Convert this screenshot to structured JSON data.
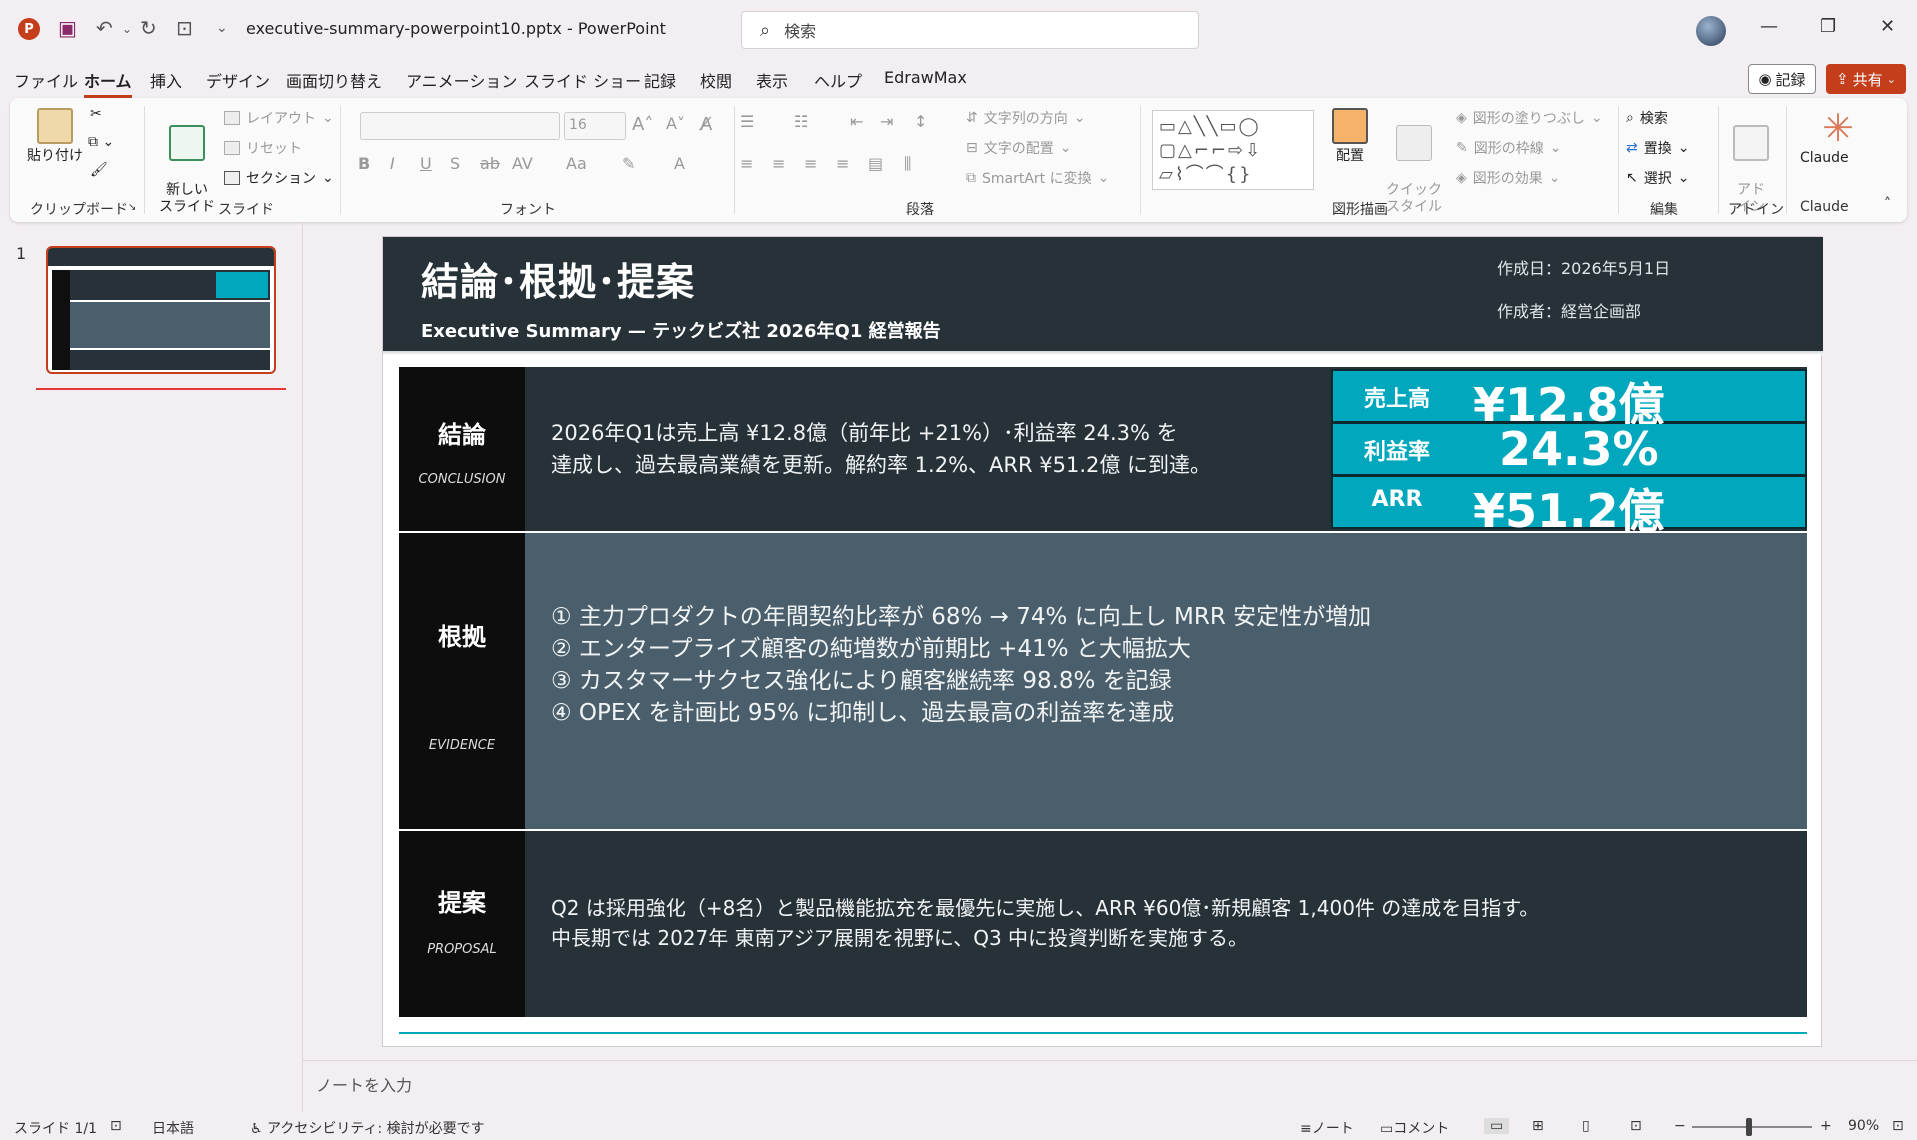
{
  "titlebar": {
    "app_icon": "P",
    "doc_title": "executive-summary-powerpoint10.pptx  -  PowerPoint",
    "search_placeholder": "検索",
    "minimize": "—",
    "restore": "❐",
    "close": "✕"
  },
  "menu": {
    "tabs": [
      "ファイル",
      "ホーム",
      "挿入",
      "デザイン",
      "画面切り替え",
      "アニメーション",
      "スライド ショー",
      "記録",
      "校閲",
      "表示",
      "ヘルプ",
      "EdrawMax"
    ],
    "active": "ホーム",
    "record_btn": "記録",
    "share_btn": "共有"
  },
  "ribbon": {
    "clipboard": {
      "paste": "貼り付け",
      "label": "クリップボード"
    },
    "slides": {
      "new_slide": "新しい\nスライド",
      "layout": "レイアウト",
      "reset": "リセット",
      "section": "セクション",
      "label": "スライド"
    },
    "font": {
      "size": "16",
      "label": "フォント"
    },
    "paragraph": {
      "text_direction": "文字列の方向",
      "align_text": "文字の配置",
      "smartart": "SmartArt に変換",
      "label": "段落"
    },
    "drawing": {
      "arrange": "配置",
      "quick_style": "クイック\nスタイル",
      "fill": "図形の塗りつぶし",
      "outline": "図形の枠線",
      "effects": "図形の効果",
      "label": "図形描画"
    },
    "editing": {
      "find": "検索",
      "replace": "置換",
      "select": "選択",
      "label": "編集"
    },
    "addins": {
      "addin": "アド\nイン",
      "label": "アドイン"
    },
    "claude": {
      "name": "Claude",
      "label": "Claude"
    }
  },
  "thumbs": {
    "number": "1"
  },
  "slide": {
    "title": "結論･根拠･提案",
    "subtitle": "Executive Summary — テックビズ社 2026年Q1 経営報告",
    "date": "作成日：2026年5月1日",
    "author": "作成者：経営企画部",
    "conclusion": {
      "label_jp": "結論",
      "label_en": "CONCLUSION",
      "lines": [
        "2026年Q1は売上高 ¥12.8億（前年比 +21%）･利益率 24.3% を",
        "達成し、過去最高業績を更新。解約率 1.2%、ARR ¥51.2億 に到達。"
      ]
    },
    "kpis": [
      {
        "label": "売上高",
        "value": "¥12.8億"
      },
      {
        "label": "利益率",
        "value": "24.3%"
      },
      {
        "label": "ARR",
        "value": "¥51.2億"
      }
    ],
    "evidence": {
      "label_jp": "根拠",
      "label_en": "EVIDENCE",
      "lines": [
        "① 主力プロダクトの年間契約比率が 68% → 74% に向上し MRR 安定性が増加",
        "② エンタープライズ顧客の純増数が前期比 +41% と大幅拡大",
        "③ カスタマーサクセス強化により顧客継続率 98.8% を記録",
        "④ OPEX を計画比 95% に抑制し、過去最高の利益率を達成"
      ]
    },
    "proposal": {
      "label_jp": "提案",
      "label_en": "PROPOSAL",
      "lines": [
        "Q2 は採用強化（+8名）と製品機能拡充を最優先に実施し、ARR ¥60億･新規顧客 1,400件 の達成を目指す。",
        "中長期では 2027年 東南アジア展開を視野に、Q3 中に投資判断を実施する。"
      ]
    }
  },
  "notes_placeholder": "ノートを入力",
  "status": {
    "slide": "スライド 1/1",
    "language": "日本語",
    "accessibility": "アクセシビリティ: 検討が必要です",
    "notes": "ノート",
    "comments": "コメント",
    "zoom": "90%"
  },
  "colors": {
    "accent": "#c43e1c",
    "header": "#263238",
    "teal": "#00a7bd",
    "evidence_bg": "#4a5f6b",
    "label_bg": "#0d0d0d"
  }
}
